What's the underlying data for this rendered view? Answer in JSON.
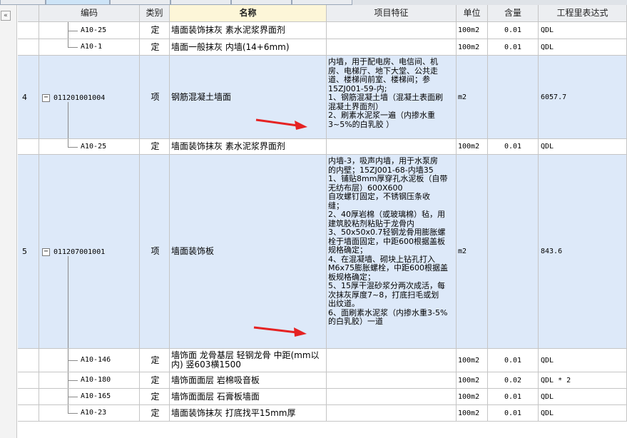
{
  "columns": {
    "seq": "",
    "code": "编码",
    "type": "类别",
    "name": "名称",
    "feature": "项目特征",
    "unit": "单位",
    "quantity": "含量",
    "expr": "工程里表达式"
  },
  "sidebar": {
    "collapse_glyph": "«"
  },
  "rows": [
    {
      "seq": "",
      "code": "A10-25",
      "type": "定",
      "name": "墙面装饰抹灰 素水泥浆界面剂",
      "feature": "",
      "unit": "100m2",
      "qty": "0.01",
      "expr": "QDL"
    },
    {
      "seq": "",
      "code": "A10-1",
      "type": "定",
      "name": "墙面一般抹灰 内墙(14+6mm)",
      "feature": "",
      "unit": "100m2",
      "qty": "0.01",
      "expr": "QDL"
    },
    {
      "seq": "4",
      "code": "011201001004",
      "expander": "−",
      "type": "项",
      "name": "钢筋混凝土墙面",
      "feature": "内墙，用于配电房、电信间、机\n房、电梯厅、地下大堂、公共走\n道、楼梯间前室、楼梯间；参\n15ZJ001-59-内;\n1、钢筋混凝土墙（混凝土表面刷\n混凝土界面剂）\n2、刷素水泥浆一遍（内掺水重\n3~5%的白乳胶 ）",
      "unit": "m2",
      "qty": "",
      "expr": "6057.7"
    },
    {
      "seq": "",
      "code": "A10-25",
      "type": "定",
      "name": "墙面装饰抹灰 素水泥浆界面剂",
      "feature": "",
      "unit": "100m2",
      "qty": "0.01",
      "expr": "QDL"
    },
    {
      "seq": "5",
      "code": "011207001001",
      "expander": "−",
      "type": "项",
      "name": "墙面装饰板",
      "feature": "内墙-3，吸声内墙，用于水泵房\n的内壁；15ZJ001-68-内墙35\n1、铺贴8mm厚穿孔水泥板（自带\n无纺布层）600X600\n自攻螺钉固定，不锈钢压条收\n缝；\n2、40厚岩棉（或玻璃棉）毡，用\n建筑胶粘剂粘贴于龙骨内\n3、50x50x0.7轻钢龙骨用膨胀螺\n栓于墙面固定，中距600根据盖板\n规格确定；\n4、在混凝墙、砌块上钻孔打入\nM6x75膨胀螺栓，中距600根据盖\n板规格确定；\n5、15厚干混砂浆分两次成活，每\n次抹灰厚度7~8，打底扫毛或划\n出纹道。\n6、面刷素水泥浆（内掺水重3-5%\n的白乳胶）一道",
      "unit": "m2",
      "qty": "",
      "expr": "843.6"
    },
    {
      "seq": "",
      "code": "A10-146",
      "type": "定",
      "name": "墙饰面 龙骨基层 轻钢龙骨 中距(mm以\n内) 竖603横1500",
      "feature": "",
      "unit": "100m2",
      "qty": "0.01",
      "expr": "QDL"
    },
    {
      "seq": "",
      "code": "A10-180",
      "type": "定",
      "name": "墙饰面面层 岩棉吸音板",
      "feature": "",
      "unit": "100m2",
      "qty": "0.02",
      "expr": "QDL * 2"
    },
    {
      "seq": "",
      "code": "A10-165",
      "type": "定",
      "name": "墙饰面面层 石膏板墙面",
      "feature": "",
      "unit": "100m2",
      "qty": "0.01",
      "expr": "QDL"
    },
    {
      "seq": "",
      "code": "A10-23",
      "type": "定",
      "name": "墙面装饰抹灰 打底找平15mm厚",
      "feature": "",
      "unit": "100m2",
      "qty": "0.01",
      "expr": "QDL"
    }
  ],
  "colors": {
    "header_bg": "#eceef1",
    "name_header_bg": "#fdf6d8",
    "parent_row_bg": "#dde9f9",
    "grid_line": "#c5c5c5",
    "arrow": "#e52222"
  }
}
